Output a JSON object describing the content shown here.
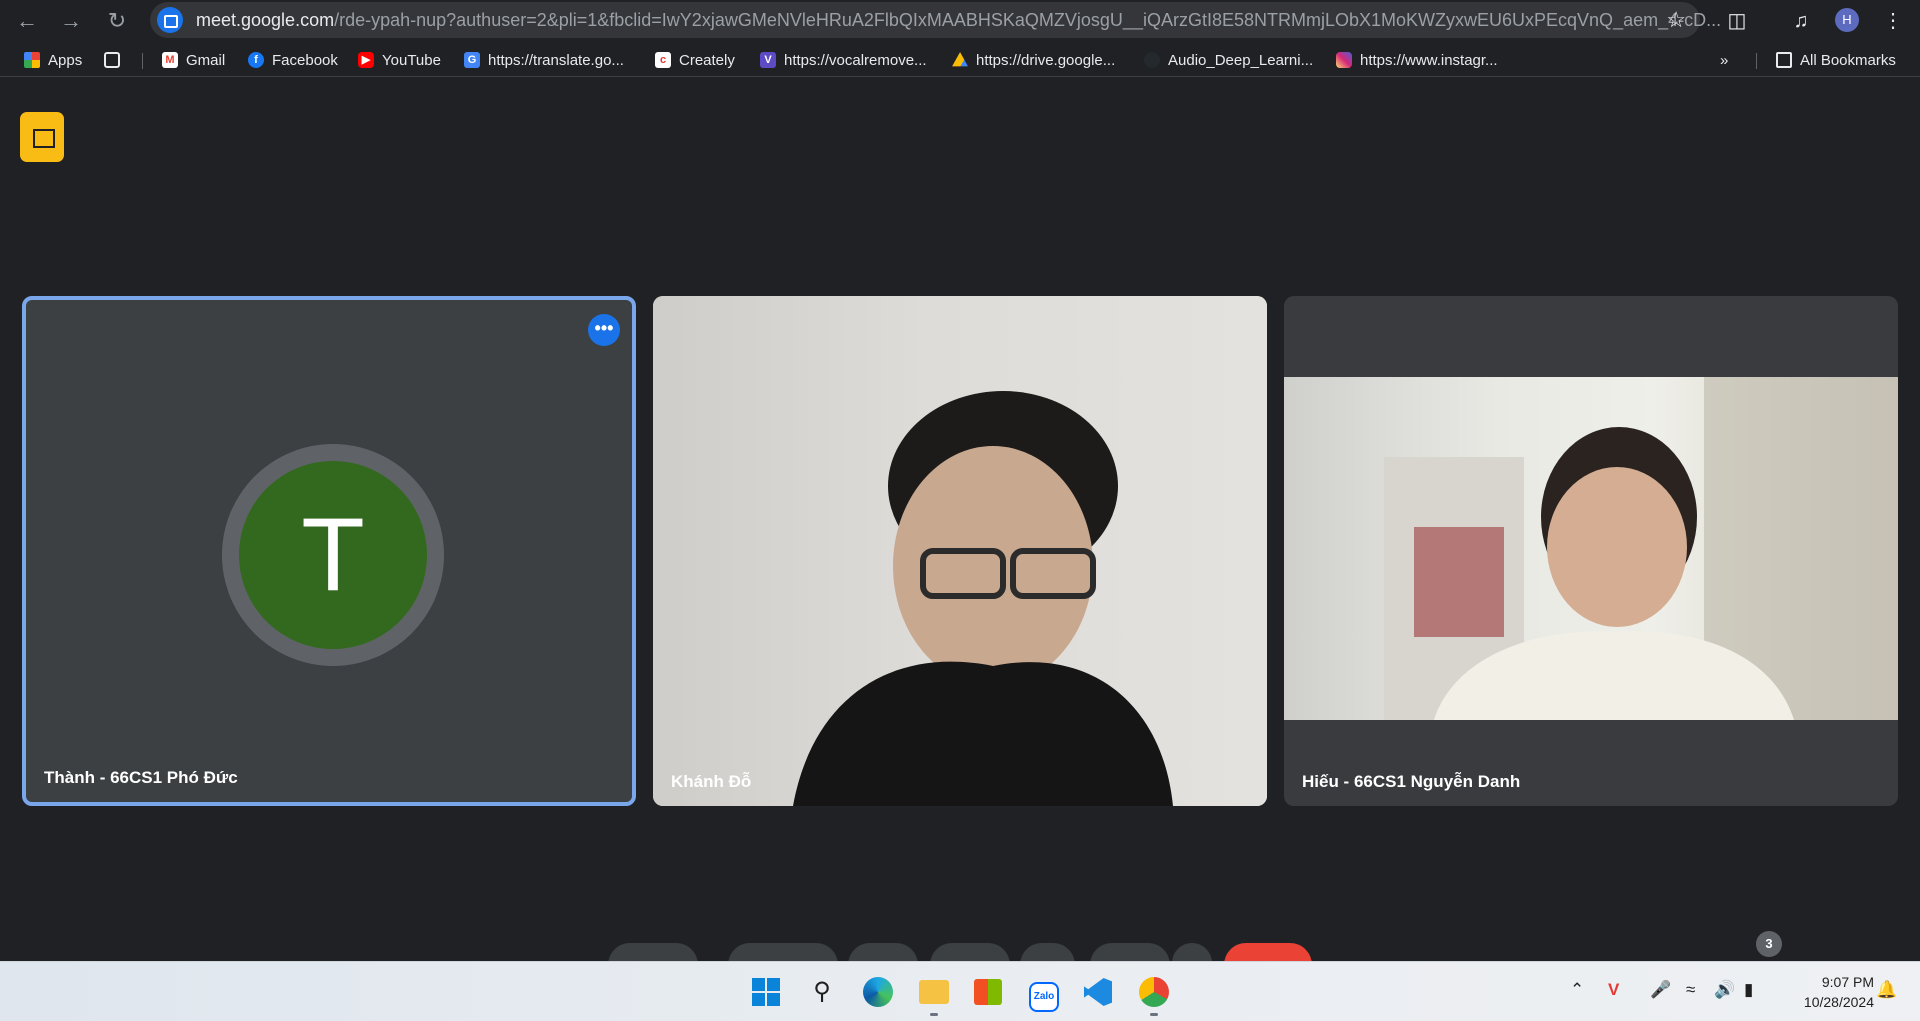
{
  "browser": {
    "url_host": "meet.google.com",
    "url_rest": "/rde-ypah-nup?authuser=2&pli=1&fbclid=IwY2xjawGMeNVleHRuA2FlbQIxMAABHSKaQMZVjosgU__iQArzGtI8E58NTRMmjLObX1MoKWZyxwEU6UxPEcqVnQ_aem_4-cD...",
    "profile_initial": "H"
  },
  "bookmarks": {
    "items": [
      {
        "label": "Apps",
        "icon": "apps-grid-icon"
      },
      {
        "label": "Gmail",
        "icon": "gmail-icon"
      },
      {
        "label": "Facebook",
        "icon": "facebook-icon"
      },
      {
        "label": "YouTube",
        "icon": "youtube-icon"
      },
      {
        "label": "https://translate.go...",
        "icon": "translate-icon"
      },
      {
        "label": "Creately",
        "icon": "creately-icon"
      },
      {
        "label": "https://vocalremove...",
        "icon": "vocalremover-icon"
      },
      {
        "label": "https://drive.google...",
        "icon": "drive-icon"
      },
      {
        "label": "Audio_Deep_Learni...",
        "icon": "github-icon"
      },
      {
        "label": "https://www.instagr...",
        "icon": "instagram-icon"
      }
    ],
    "all_bookmarks": "All Bookmarks",
    "overflow": "»"
  },
  "meet": {
    "participants": [
      {
        "name": "Thành - 66CS1 Phó Đức",
        "avatar_letter": "T",
        "avatar_color": "#33691e"
      },
      {
        "name": "Khánh Đỗ"
      },
      {
        "name": "Hiếu - 66CS1 Nguyễn Danh"
      }
    ],
    "more_options": "•••",
    "people_count": "3"
  },
  "taskbar": {
    "apps": [
      "windows-start-icon",
      "search-icon",
      "edge-icon",
      "file-explorer-icon",
      "microsoft-store-icon",
      "zalo-icon",
      "vscode-icon",
      "chrome-icon"
    ],
    "zalo_label": "Zalo",
    "time": "9:07 PM",
    "date": "10/28/2024"
  }
}
